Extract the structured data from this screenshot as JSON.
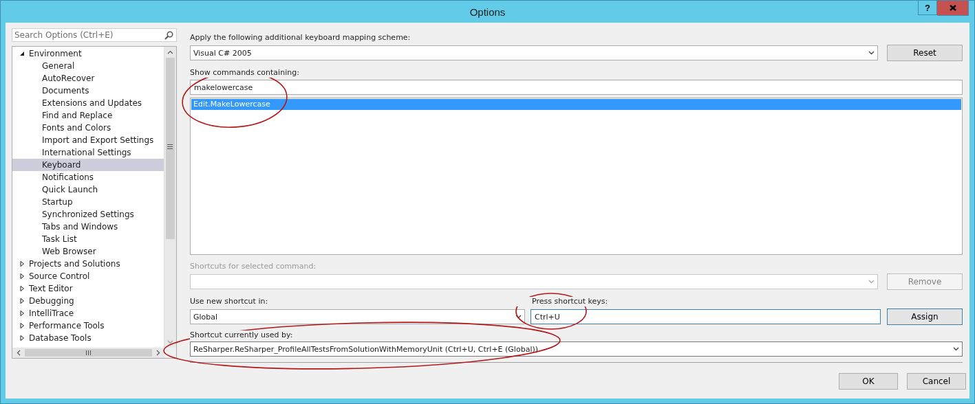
{
  "window": {
    "title": "Options",
    "help_button": "?"
  },
  "search": {
    "placeholder": "Search Options (Ctrl+E)"
  },
  "tree": [
    {
      "label": "Environment",
      "expanded": true,
      "selected": false,
      "children": [
        {
          "label": "General",
          "selected": false
        },
        {
          "label": "AutoRecover",
          "selected": false
        },
        {
          "label": "Documents",
          "selected": false
        },
        {
          "label": "Extensions and Updates",
          "selected": false
        },
        {
          "label": "Find and Replace",
          "selected": false
        },
        {
          "label": "Fonts and Colors",
          "selected": false
        },
        {
          "label": "Import and Export Settings",
          "selected": false
        },
        {
          "label": "International Settings",
          "selected": false
        },
        {
          "label": "Keyboard",
          "selected": true
        },
        {
          "label": "Notifications",
          "selected": false
        },
        {
          "label": "Quick Launch",
          "selected": false
        },
        {
          "label": "Startup",
          "selected": false
        },
        {
          "label": "Synchronized Settings",
          "selected": false
        },
        {
          "label": "Tabs and Windows",
          "selected": false
        },
        {
          "label": "Task List",
          "selected": false
        },
        {
          "label": "Web Browser",
          "selected": false
        }
      ]
    },
    {
      "label": "Projects and Solutions",
      "expanded": false,
      "selected": false
    },
    {
      "label": "Source Control",
      "expanded": false,
      "selected": false
    },
    {
      "label": "Text Editor",
      "expanded": false,
      "selected": false
    },
    {
      "label": "Debugging",
      "expanded": false,
      "selected": false
    },
    {
      "label": "IntelliTrace",
      "expanded": false,
      "selected": false
    },
    {
      "label": "Performance Tools",
      "expanded": false,
      "selected": false
    },
    {
      "label": "Database Tools",
      "expanded": false,
      "selected": false
    }
  ],
  "keyboard": {
    "scheme_label": "Apply the following additional keyboard mapping scheme:",
    "scheme": "Visual C# 2005",
    "reset_button": "Reset",
    "commands_label": "Show commands containing:",
    "commands_filter": "makelowercase",
    "commands": [
      {
        "label": "Edit.MakeLowercase",
        "selected": true
      }
    ],
    "shortcuts_label": {
      "text": "Shortcuts for selected command:",
      "disabled": true
    },
    "shortcuts_combo": {
      "disabled": true
    },
    "remove_button": {
      "label": "Remove",
      "disabled": true
    },
    "scope_label": "Use new shortcut in:",
    "scope": "Global",
    "keys_label": "Press shortcut keys:",
    "keys": "Ctrl+U",
    "assign_button": {
      "label": "Assign",
      "disabled": false
    },
    "used_by_label": "Shortcut currently used by:",
    "used_by": "ReSharper.ReSharper_ProfileAllTestsFromSolutionWithMemoryUnit (Ctrl+U, Ctrl+E (Global))"
  },
  "buttons": [
    "OK",
    "Cancel"
  ]
}
